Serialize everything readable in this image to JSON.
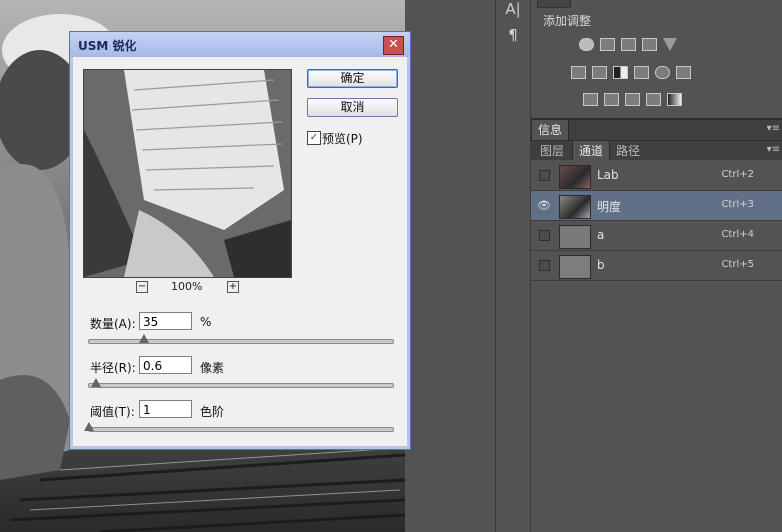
{
  "dialog": {
    "title": "USM 锐化",
    "close_glyph": "✕",
    "zoom": "100%",
    "zoom_out": "−",
    "zoom_in": "+",
    "ok_label": "确定",
    "cancel_label": "取消",
    "preview_label": "预览(P)",
    "preview_checked": true,
    "check_glyph": "✓",
    "amount": {
      "label": "数量(A):",
      "value": "35",
      "unit": "%",
      "fraction": 0.19
    },
    "radius": {
      "label": "半径(R):",
      "value": "0.6",
      "unit": "像素",
      "fraction": 0.02
    },
    "threshold": {
      "label": "阈值(T):",
      "value": "1",
      "unit": "色阶",
      "fraction": 0.0
    }
  },
  "toolstrip": {
    "type_tool": "A|",
    "paragraph": "¶"
  },
  "adjustments": {
    "title": "添加调整",
    "icons_row1": [
      "brightness-icon",
      "levels-icon",
      "curves-icon",
      "exposure-icon",
      "vibrance-icon"
    ],
    "icons_row2": [
      "hue-saturation-icon",
      "color-balance-icon",
      "black-white-icon",
      "photo-filter-icon",
      "channel-mixer-icon",
      "color-lookup-icon"
    ],
    "icons_row3": [
      "invert-icon",
      "posterize-icon",
      "threshold-icon",
      "selective-color-icon",
      "gradient-map-icon"
    ]
  },
  "info_panel": {
    "tab": "信息",
    "menu": "▾≡"
  },
  "layers_panel": {
    "tabs": [
      "图层",
      "通道",
      "路径"
    ],
    "active_tab": "通道",
    "menu": "▾≡",
    "channels": [
      {
        "name": "Lab",
        "shortcut": "Ctrl+2",
        "visible": false,
        "selected": false
      },
      {
        "name": "明度",
        "shortcut": "Ctrl+3",
        "visible": true,
        "selected": true
      },
      {
        "name": "a",
        "shortcut": "Ctrl+4",
        "visible": false,
        "selected": false
      },
      {
        "name": "b",
        "shortcut": "Ctrl+5",
        "visible": false,
        "selected": false
      }
    ],
    "eye_glyph": "👁"
  },
  "colors": {
    "selection": "#627087",
    "panel_bg": "#535353",
    "dialog_border": "#5a6fbd"
  }
}
